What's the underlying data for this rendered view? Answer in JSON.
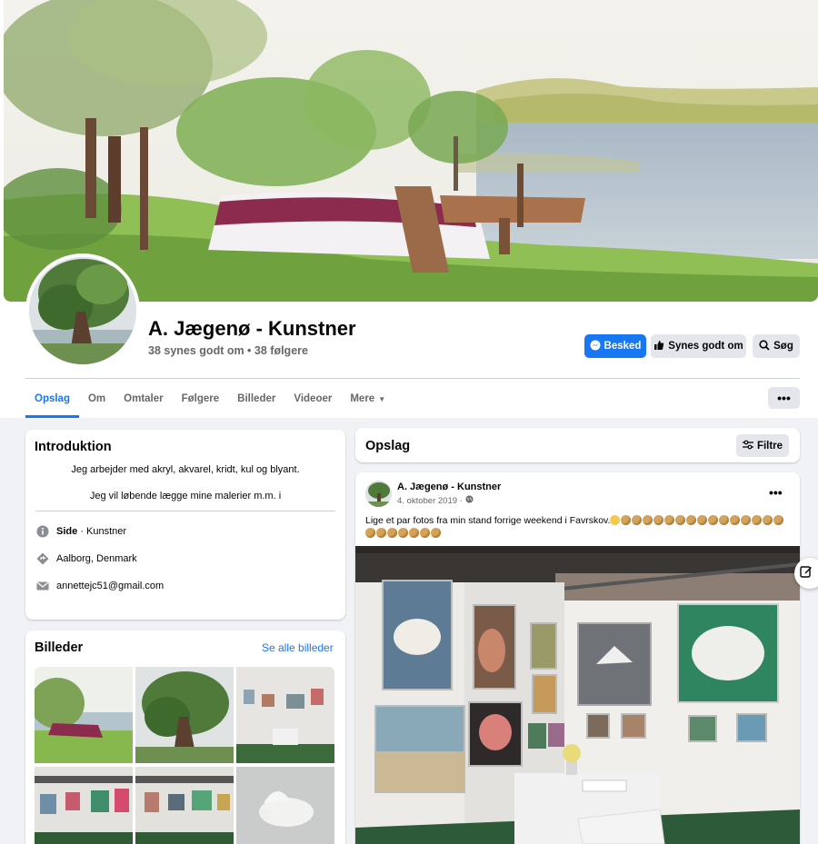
{
  "page": {
    "name": "A. Jægenø - Kunstner",
    "stats": "38 synes godt om • 38 følgere"
  },
  "actions": {
    "message_label": "Besked",
    "like_label": "Synes godt om",
    "search_label": "Søg"
  },
  "tabs": [
    {
      "label": "Opslag",
      "active": true
    },
    {
      "label": "Om"
    },
    {
      "label": "Omtaler"
    },
    {
      "label": "Følgere"
    },
    {
      "label": "Billeder"
    },
    {
      "label": "Videoer"
    },
    {
      "label": "Mere"
    }
  ],
  "more_button": "•••",
  "intro": {
    "title": "Introduktion",
    "lines": [
      "Jeg arbejder med akryl, akvarel, kridt, kul og blyant.",
      "Jeg vil løbende lægge mine malerier m.m. i"
    ],
    "category_prefix": "Side",
    "category": " · Kunstner",
    "location": "Aalborg, Denmark",
    "email": "annettejc51@gmail.com"
  },
  "photos": {
    "title": "Billeder",
    "see_all": "Se alle billeder"
  },
  "feed": {
    "title": "Opslag",
    "filter_label": "Filtre"
  },
  "post": {
    "author": "A. Jægenø - Kunstner",
    "date": "4. oktober 2019 ·",
    "menu": "•••",
    "text": "Lige et par fotos fra min stand forrige weekend i Favrskov."
  },
  "colors": {
    "accent": "#1877f2",
    "background": "#f0f2f5",
    "secondary_text": "#65676b"
  }
}
